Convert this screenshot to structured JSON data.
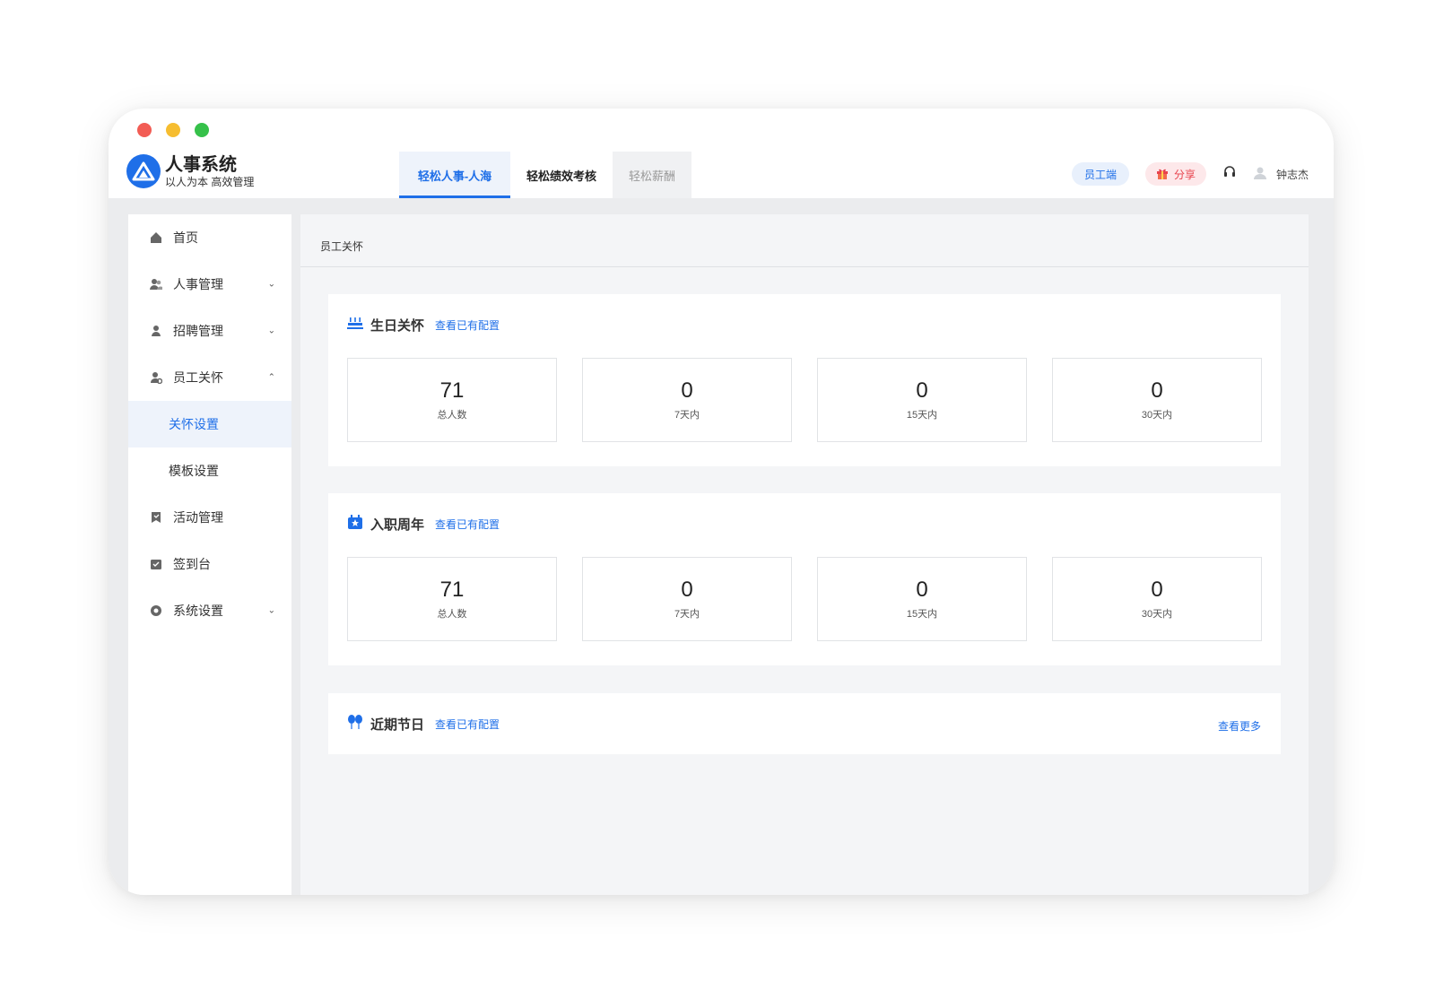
{
  "brand": {
    "title": "人事系统",
    "subtitle": "以人为本 高效管理"
  },
  "tabs": [
    "轻松人事-人海",
    "轻松绩效考核",
    "轻松薪酬"
  ],
  "top_right": {
    "employee_portal": "员工端",
    "share": "分享",
    "user_name": "钟志杰"
  },
  "sidebar": {
    "items": [
      {
        "label": "首页",
        "icon": "home-icon"
      },
      {
        "label": "人事管理",
        "icon": "people-icon"
      },
      {
        "label": "招聘管理",
        "icon": "person-icon"
      },
      {
        "label": "员工关怀",
        "icon": "person-care-icon"
      },
      {
        "label": "关怀设置"
      },
      {
        "label": "模板设置"
      },
      {
        "label": "活动管理",
        "icon": "bookmark-icon"
      },
      {
        "label": "签到台",
        "icon": "checkin-icon"
      },
      {
        "label": "系统设置",
        "icon": "settings-icon"
      }
    ]
  },
  "content": {
    "breadcrumb": "员工关怀",
    "birthday": {
      "title": "生日关怀",
      "link": "查看已有配置",
      "stats": [
        {
          "value": "71",
          "label": "总人数"
        },
        {
          "value": "0",
          "label": "7天内"
        },
        {
          "value": "0",
          "label": "15天内"
        },
        {
          "value": "0",
          "label": "30天内"
        }
      ]
    },
    "anniversary": {
      "title": "入职周年",
      "link": "查看已有配置",
      "stats": [
        {
          "value": "71",
          "label": "总人数"
        },
        {
          "value": "0",
          "label": "7天内"
        },
        {
          "value": "0",
          "label": "15天内"
        },
        {
          "value": "0",
          "label": "30天内"
        }
      ]
    },
    "holidays": {
      "title": "近期节日",
      "link": "查看已有配置",
      "more": "查看更多"
    }
  },
  "colors": {
    "accent": "#1f6fe8",
    "share_red": "#e8434d"
  }
}
